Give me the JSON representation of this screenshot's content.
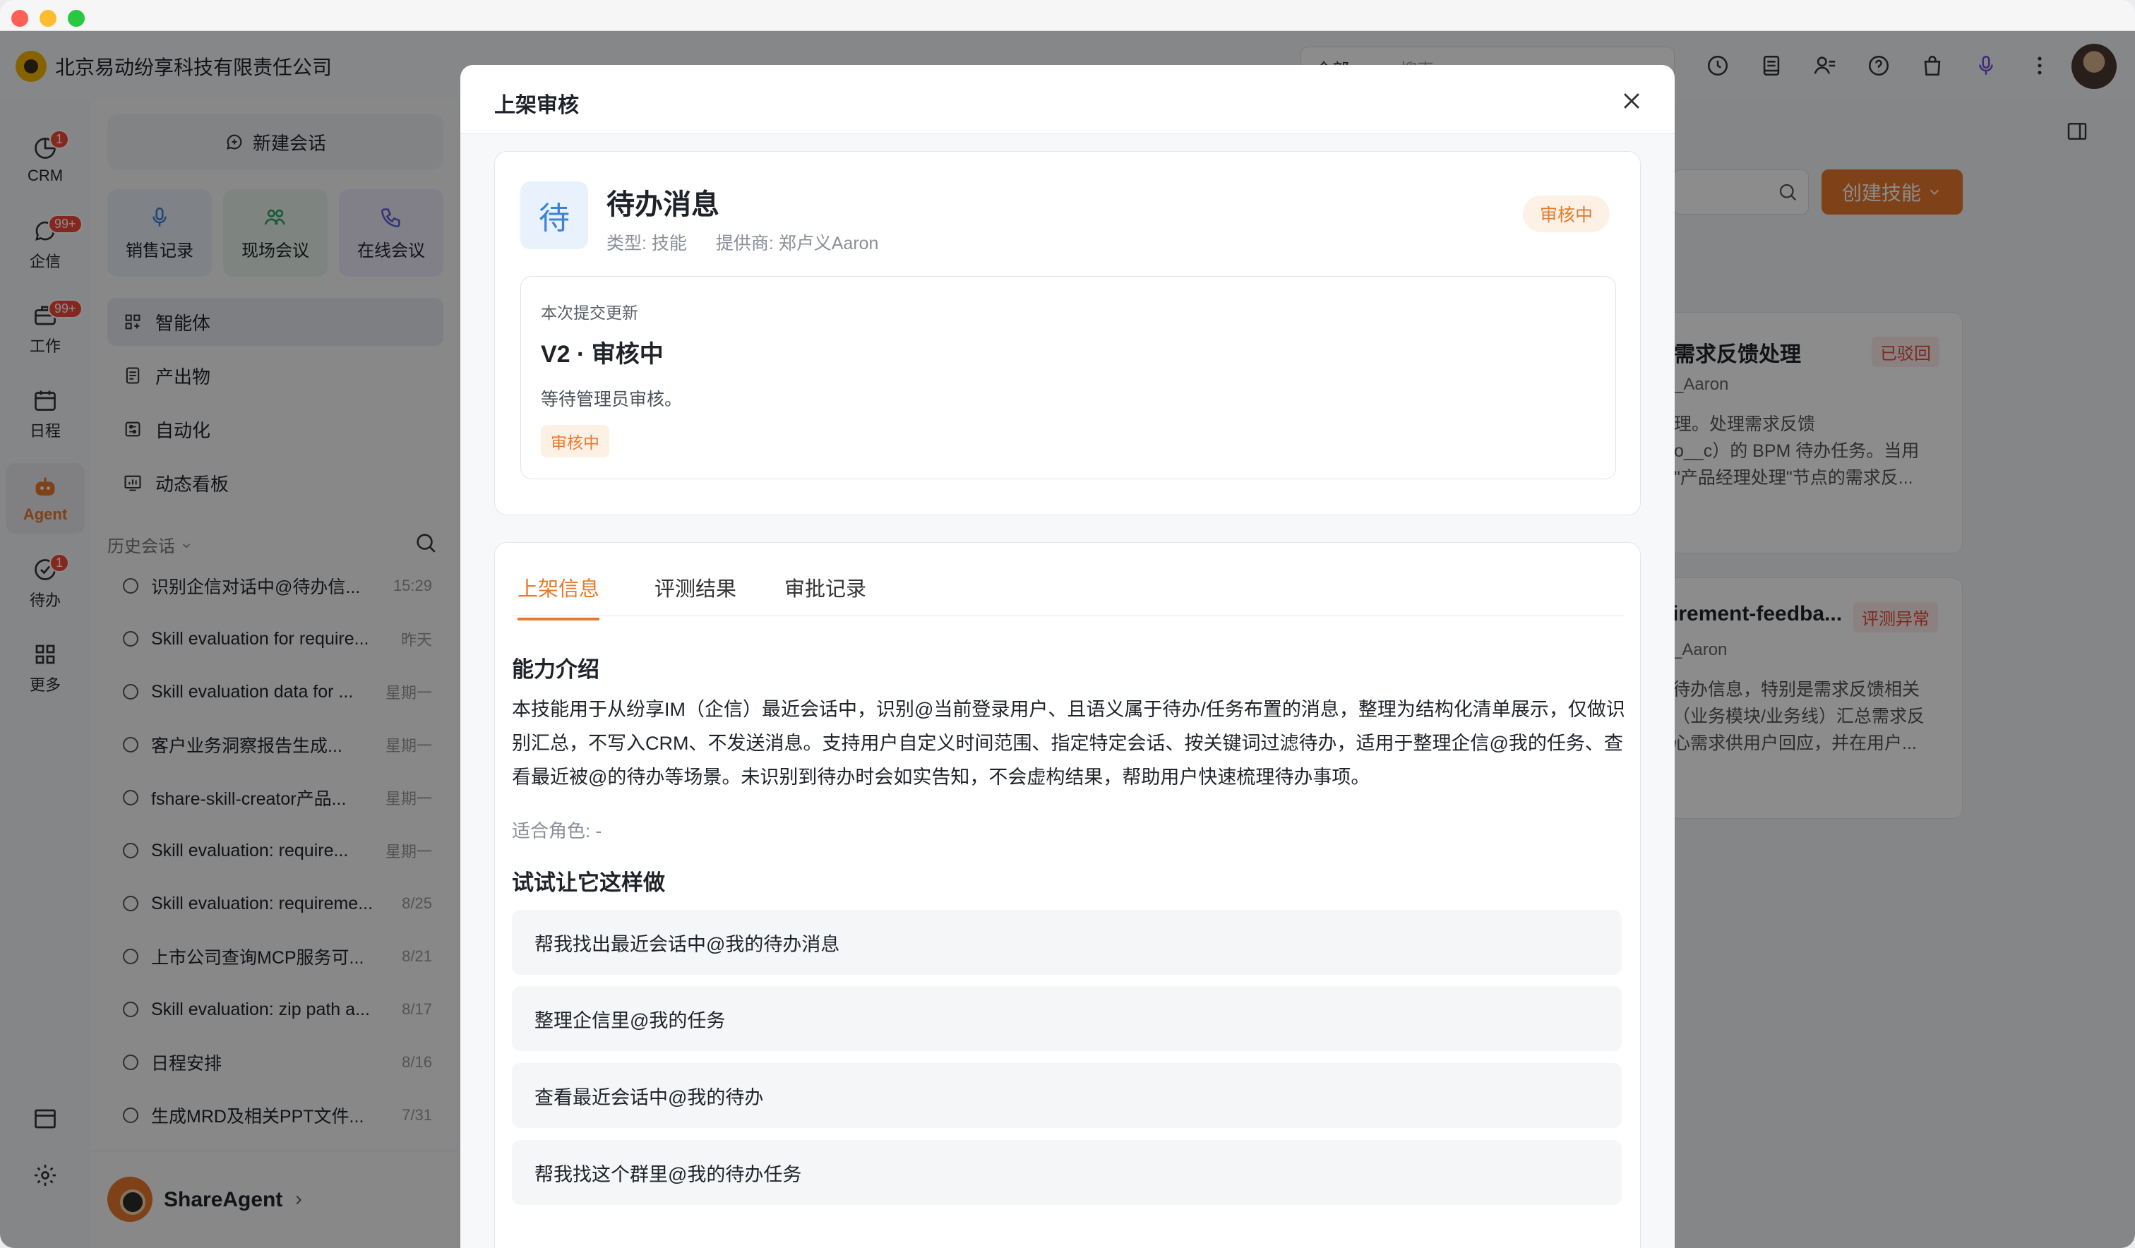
{
  "window": {
    "company": "北京易动纷享科技有限责任公司",
    "search": {
      "scope": "全部",
      "placeholder": "搜索"
    }
  },
  "leftnav": {
    "items": [
      {
        "label": "CRM",
        "badge": "1",
        "icon": "crm-icon"
      },
      {
        "label": "企信",
        "badge": "99+",
        "icon": "chat-icon"
      },
      {
        "label": "工作",
        "badge": "99+",
        "icon": "work-icon"
      },
      {
        "label": "日程",
        "badge": "",
        "icon": "calendar-icon"
      },
      {
        "label": "Agent",
        "badge": "",
        "icon": "agent-icon"
      },
      {
        "label": "待办",
        "badge": "1",
        "icon": "todo-icon"
      },
      {
        "label": "更多",
        "badge": "",
        "icon": "grid-icon"
      }
    ]
  },
  "sidebar": {
    "new_chat": "新建会话",
    "quick": [
      {
        "label": "销售记录",
        "icon": "mic-icon"
      },
      {
        "label": "现场会议",
        "icon": "meeting-icon"
      },
      {
        "label": "在线会议",
        "icon": "phone-icon"
      }
    ],
    "menu": [
      {
        "label": "智能体",
        "icon": "agents-icon"
      },
      {
        "label": "产出物",
        "icon": "output-icon"
      },
      {
        "label": "自动化",
        "icon": "automation-icon"
      },
      {
        "label": "动态看板",
        "icon": "dashboard-icon"
      }
    ],
    "history_title": "历史会话",
    "history": [
      {
        "title": "识别企信对话中@待办信...",
        "time": "15:29"
      },
      {
        "title": "Skill evaluation for require...",
        "time": "昨天"
      },
      {
        "title": "Skill evaluation data for ...",
        "time": "星期一"
      },
      {
        "title": "客户业务洞察报告生成...",
        "time": "星期一"
      },
      {
        "title": "fshare-skill-creator产品...",
        "time": "星期一"
      },
      {
        "title": "Skill evaluation: require...",
        "time": "星期一"
      },
      {
        "title": "Skill evaluation: requireme...",
        "time": "8/25"
      },
      {
        "title": "上市公司查询MCP服务可...",
        "time": "8/21"
      },
      {
        "title": "Skill evaluation: zip path a...",
        "time": "8/17"
      },
      {
        "title": "日程安排",
        "time": "8/16"
      },
      {
        "title": "生成MRD及相关PPT文件...",
        "time": "7/31"
      }
    ],
    "footer_name": "ShareAgent"
  },
  "background": {
    "create_button": "创建技能",
    "card1": {
      "title": "需求反馈处理",
      "status": "已驳回",
      "owner": "_Aaron",
      "desc": [
        "理。处理需求反馈",
        "o__c）的 BPM 待办任务。当用",
        "\"产品经理处理\"节点的需求反..."
      ]
    },
    "card2": {
      "title": "irement-feedba...",
      "status": "评测异常",
      "owner": "_Aaron",
      "desc": [
        "待办信息，特别是需求反馈相关",
        "（业务模块/业务线）汇总需求反",
        "心需求供用户回应，并在用户..."
      ]
    }
  },
  "modal": {
    "title": "上架审核",
    "skill": {
      "icon_char": "待",
      "name": "待办消息",
      "type": "类型: 技能",
      "provider": "提供商: 郑卢义Aaron",
      "status": "审核中"
    },
    "update": {
      "label": "本次提交更新",
      "title": "V2 · 审核中",
      "desc": "等待管理员审核。",
      "tag": "审核中"
    },
    "tabs": [
      "上架信息",
      "评测结果",
      "审批记录"
    ],
    "ability_title": "能力介绍",
    "ability_desc": "本技能用于从纷享IM（企信）最近会话中，识别@当前登录用户、且语义属于待办/任务布置的消息，整理为结构化清单展示，仅做识别汇总，不写入CRM、不发送消息。支持用户自定义时间范围、指定特定会话、按关键词过滤待办，适用于整理企信@我的任务、查看最近被@的待办等场景。未识别到待办时会如实告知，不会虚构结果，帮助用户快速梳理待办事项。",
    "roles": "适合角色: -",
    "try_title": "试试让它这样做",
    "try_items": [
      "帮我找出最近会话中@我的待办消息",
      "整理企信里@我的任务",
      "查看最近会话中@我的待办",
      "帮我找这个群里@我的待办任务"
    ]
  },
  "colors": {
    "accent": "#e8792c",
    "badge": "#f04a3a",
    "skill_icon": "#3c82d9"
  }
}
